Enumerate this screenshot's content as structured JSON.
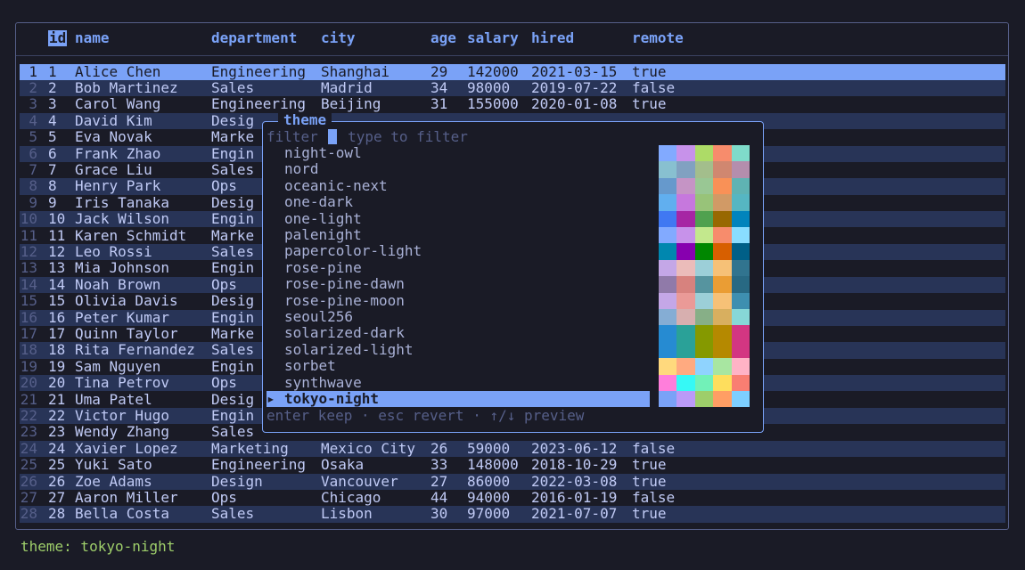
{
  "table": {
    "headers": [
      "id",
      "name",
      "department",
      "city",
      "age",
      "salary",
      "hired",
      "remote"
    ],
    "rows": [
      [
        "1",
        "Alice Chen",
        "Engineering",
        "Shanghai",
        "29",
        "142000",
        "2021-03-15",
        "true"
      ],
      [
        "2",
        "Bob Martinez",
        "Sales",
        "Madrid",
        "34",
        "98000",
        "2019-07-22",
        "false"
      ],
      [
        "3",
        "Carol Wang",
        "Engineering",
        "Beijing",
        "31",
        "155000",
        "2020-01-08",
        "true"
      ],
      [
        "4",
        "David Kim",
        "Desig",
        "",
        "",
        "",
        "",
        ""
      ],
      [
        "5",
        "Eva Novak",
        "Marke",
        "",
        "",
        "",
        "",
        ""
      ],
      [
        "6",
        "Frank Zhao",
        "Engin",
        "",
        "",
        "",
        "",
        ""
      ],
      [
        "7",
        "Grace Liu",
        "Sales",
        "",
        "",
        "",
        "",
        ""
      ],
      [
        "8",
        "Henry Park",
        "Ops",
        "",
        "",
        "",
        "",
        ""
      ],
      [
        "9",
        "Iris Tanaka",
        "Desig",
        "",
        "",
        "",
        "",
        ""
      ],
      [
        "10",
        "Jack Wilson",
        "Engin",
        "",
        "",
        "",
        "",
        ""
      ],
      [
        "11",
        "Karen Schmidt",
        "Marke",
        "",
        "",
        "",
        "",
        ""
      ],
      [
        "12",
        "Leo Rossi",
        "Sales",
        "",
        "",
        "",
        "",
        ""
      ],
      [
        "13",
        "Mia Johnson",
        "Engin",
        "",
        "",
        "",
        "",
        ""
      ],
      [
        "14",
        "Noah Brown",
        "Ops",
        "",
        "",
        "",
        "",
        ""
      ],
      [
        "15",
        "Olivia Davis",
        "Desig",
        "",
        "",
        "",
        "",
        ""
      ],
      [
        "16",
        "Peter Kumar",
        "Engin",
        "",
        "",
        "",
        "",
        ""
      ],
      [
        "17",
        "Quinn Taylor",
        "Marke",
        "",
        "",
        "",
        "",
        ""
      ],
      [
        "18",
        "Rita Fernandez",
        "Sales",
        "",
        "",
        "",
        "",
        ""
      ],
      [
        "19",
        "Sam Nguyen",
        "Engin",
        "",
        "",
        "",
        "",
        ""
      ],
      [
        "20",
        "Tina Petrov",
        "Ops",
        "",
        "",
        "",
        "",
        ""
      ],
      [
        "21",
        "Uma Patel",
        "Desig",
        "",
        "",
        "",
        "",
        ""
      ],
      [
        "22",
        "Victor Hugo",
        "Engin",
        "",
        "",
        "",
        "",
        ""
      ],
      [
        "23",
        "Wendy Zhang",
        "Sales",
        "",
        "",
        "",
        "",
        ""
      ],
      [
        "24",
        "Xavier Lopez",
        "Marketing",
        "Mexico City",
        "26",
        "59000",
        "2023-06-12",
        "false"
      ],
      [
        "25",
        "Yuki Sato",
        "Engineering",
        "Osaka",
        "33",
        "148000",
        "2018-10-29",
        "true"
      ],
      [
        "26",
        "Zoe Adams",
        "Design",
        "Vancouver",
        "27",
        "86000",
        "2022-03-08",
        "true"
      ],
      [
        "27",
        "Aaron Miller",
        "Ops",
        "Chicago",
        "44",
        "94000",
        "2016-01-19",
        "false"
      ],
      [
        "28",
        "Bella Costa",
        "Sales",
        "Lisbon",
        "30",
        "97000",
        "2021-07-07",
        "true"
      ]
    ],
    "line_numbers": [
      "1",
      "2",
      "3",
      "4",
      "5",
      "6",
      "7",
      "8",
      "9",
      "10",
      "11",
      "12",
      "13",
      "14",
      "15",
      "16",
      "17",
      "18",
      "19",
      "20",
      "21",
      "22",
      "23",
      "24",
      "25",
      "26",
      "27",
      "28"
    ],
    "selected_row": 1
  },
  "theme_picker": {
    "title": "theme",
    "filter_label": "filter",
    "filter_placeholder": "type to filter",
    "selected_marker": "▸",
    "footer": "enter keep · esc revert · ↑/↓ preview",
    "themes": [
      {
        "name": "night-owl",
        "swatches": [
          "#82aaff",
          "#c792ea",
          "#addb67",
          "#f78c6c",
          "#7fdbca"
        ]
      },
      {
        "name": "nord",
        "swatches": [
          "#88c0d0",
          "#81a1c1",
          "#a3be8c",
          "#d08770",
          "#b48ead"
        ]
      },
      {
        "name": "oceanic-next",
        "swatches": [
          "#6699cc",
          "#c594c5",
          "#99c794",
          "#f99157",
          "#5fb3b3"
        ]
      },
      {
        "name": "one-dark",
        "swatches": [
          "#61afef",
          "#c678dd",
          "#98c379",
          "#d19a66",
          "#56b6c2"
        ]
      },
      {
        "name": "one-light",
        "swatches": [
          "#4078f2",
          "#a626a4",
          "#50a14f",
          "#986801",
          "#0184bc"
        ]
      },
      {
        "name": "palenight",
        "swatches": [
          "#82aaff",
          "#c792ea",
          "#c3e88d",
          "#f78c6c",
          "#89ddff"
        ]
      },
      {
        "name": "papercolor-light",
        "swatches": [
          "#0087af",
          "#8700af",
          "#008700",
          "#d75f00",
          "#005f87"
        ]
      },
      {
        "name": "rose-pine",
        "swatches": [
          "#c4a7e7",
          "#ebbcba",
          "#9ccfd8",
          "#f6c177",
          "#31748f"
        ]
      },
      {
        "name": "rose-pine-dawn",
        "swatches": [
          "#907aa9",
          "#d7827e",
          "#56949f",
          "#ea9d34",
          "#286983"
        ]
      },
      {
        "name": "rose-pine-moon",
        "swatches": [
          "#c4a7e7",
          "#ea9a97",
          "#9ccfd8",
          "#f6c177",
          "#3e8fb0"
        ]
      },
      {
        "name": "seoul256",
        "swatches": [
          "#85add4",
          "#d7afaf",
          "#87af87",
          "#d8af5f",
          "#87d7d7"
        ]
      },
      {
        "name": "solarized-dark",
        "swatches": [
          "#268bd2",
          "#2aa198",
          "#859900",
          "#b58900",
          "#d33682"
        ]
      },
      {
        "name": "solarized-light",
        "swatches": [
          "#268bd2",
          "#2aa198",
          "#859900",
          "#b58900",
          "#d33682"
        ]
      },
      {
        "name": "sorbet",
        "swatches": [
          "#ffd97d",
          "#ffaa80",
          "#8fd3fe",
          "#a8e6a1",
          "#ffb3c6"
        ]
      },
      {
        "name": "synthwave",
        "swatches": [
          "#ff7edb",
          "#36f9f6",
          "#72f1b8",
          "#fede5d",
          "#f97e72"
        ]
      },
      {
        "name": "tokyo-night",
        "swatches": [
          "#7aa2f7",
          "#bb9af7",
          "#9ece6a",
          "#ff9e64",
          "#7dcfff"
        ]
      }
    ],
    "active_index": 15
  },
  "status_line": "theme: tokyo-night",
  "colors": {
    "background": "#1a1b26",
    "accent": "#7aa2f7",
    "stripe": "#283457",
    "status": "#9ece6a"
  }
}
